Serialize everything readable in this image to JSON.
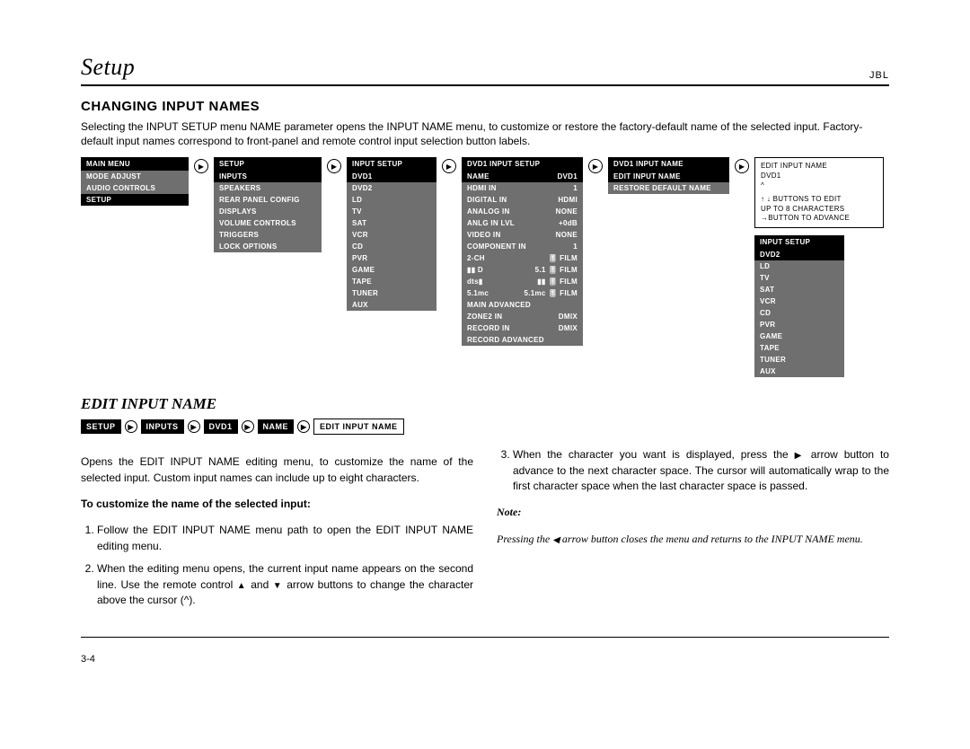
{
  "header": {
    "section": "Setup",
    "brand": "JBL"
  },
  "h_changing": "CHANGING INPUT NAMES",
  "intro": "Selecting the INPUT SETUP menu NAME parameter opens the INPUT NAME menu, to customize or restore the factory-default name of the selected input. Factory-default input names correspond to front-panel and remote control input selection button labels.",
  "menu1": {
    "title": "MAIN MENU",
    "items": [
      "MODE ADJUST",
      "AUDIO CONTROLS",
      "SETUP"
    ]
  },
  "menu2": {
    "title": "SETUP",
    "items": [
      "INPUTS",
      "SPEAKERS",
      "REAR PANEL CONFIG",
      "DISPLAYS",
      "VOLUME CONTROLS",
      "TRIGGERS",
      "LOCK OPTIONS"
    ]
  },
  "menu3": {
    "title": "INPUT SETUP",
    "items": [
      "DVD1",
      "DVD2",
      "LD",
      "TV",
      "SAT",
      "VCR",
      "CD",
      "PVR",
      "GAME",
      "TAPE",
      "TUNER",
      "AUX"
    ]
  },
  "menu4": {
    "title": "DVD1 INPUT SETUP",
    "rows": [
      {
        "l": "NAME",
        "r": "DVD1",
        "sel": true
      },
      {
        "l": "HDMI IN",
        "r": "1"
      },
      {
        "l": "DIGITAL IN",
        "r": "HDMI"
      },
      {
        "l": "ANALOG IN",
        "r": "NONE"
      },
      {
        "l": "ANLG IN LVL",
        "r": "+0dB"
      },
      {
        "l": "VIDEO IN",
        "r": "NONE"
      },
      {
        "l": "COMPONENT IN",
        "r": "1"
      },
      {
        "l": "2-CH",
        "r": "🎚 FILM"
      },
      {
        "l": "▮▮ D",
        "r": "5.1 🎚 FILM"
      },
      {
        "l": "dts▮",
        "r": "▮▮ 🎚 FILM"
      },
      {
        "l": "5.1mc",
        "r": "5.1mc 🎚 FILM"
      },
      {
        "l": "MAIN ADVANCED",
        "r": ""
      },
      {
        "l": "ZONE2 IN",
        "r": "DMIX"
      },
      {
        "l": "RECORD IN",
        "r": "DMIX"
      },
      {
        "l": "RECORD ADVANCED",
        "r": ""
      }
    ]
  },
  "menu5": {
    "title": "DVD1 INPUT NAME",
    "items": [
      "EDIT INPUT NAME",
      "RESTORE DEFAULT NAME"
    ]
  },
  "editbox": {
    "l1": "EDIT INPUT NAME",
    "l2": "DVD1",
    "l3": "^",
    "l4": "↑ ↓ BUTTONS TO EDIT",
    "l5": "UP TO 8 CHARACTERS",
    "l6": "→BUTTON TO ADVANCE"
  },
  "menu6": {
    "title": "INPUT SETUP",
    "items": [
      "DVD2",
      "LD",
      "TV",
      "SAT",
      "VCR",
      "CD",
      "PVR",
      "GAME",
      "TAPE",
      "TUNER",
      "AUX"
    ]
  },
  "subheading": "EDIT INPUT NAME",
  "crumbs": [
    "SETUP",
    "INPUTS",
    "DVD1",
    "NAME",
    "EDIT INPUT NAME"
  ],
  "left": {
    "p1": "Opens the EDIT INPUT NAME editing menu, to customize the name of the selected input. Custom input names can include up to eight characters.",
    "lead": "To customize the name of the selected input:",
    "li1": "Follow the EDIT INPUT NAME menu path to open the EDIT INPUT NAME editing menu.",
    "li2a": "When the editing menu opens, the current input name appears on the second line. Use the remote control  ",
    "li2b": "  and  ",
    "li2c": "  arrow buttons to change the character above the cursor (^)."
  },
  "right": {
    "li3a": "When the character you want is displayed, press the  ",
    "li3b": "  arrow button to advance to the next character space. The cursor will automatically wrap to the first character space when the last character space is passed.",
    "note_h": "Note:",
    "note_a": "Pressing the  ",
    "note_b": "  arrow button closes the menu and returns to the INPUT NAME menu."
  },
  "pagenum": "3-4"
}
